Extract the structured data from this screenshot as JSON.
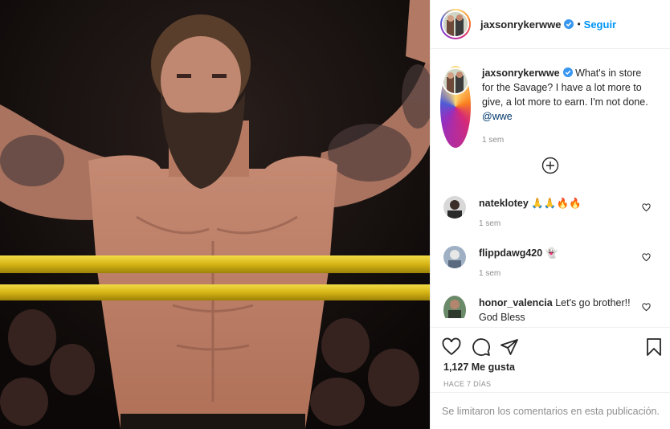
{
  "post": {
    "author": "jaxsonrykerwwe",
    "separator": "•",
    "follow_label": "Seguir",
    "caption_text": "What's in store for the Savage? I have a lot more to give, a lot more to earn. I'm not done.",
    "caption_mention": "@wwe",
    "caption_time": "1 sem",
    "likes": "1,127 Me gusta",
    "date": "HACE 7 DÍAS",
    "comments_limited": "Se limitaron los comentarios en esta publicación."
  },
  "comments": [
    {
      "user": "nateklotey",
      "text": "🙏🙏🔥🔥",
      "time": "1 sem"
    },
    {
      "user": "flippdawg420",
      "text": "👻",
      "time": "1 sem"
    },
    {
      "user": "honor_valencia",
      "text": "Let's go brother!! God Bless",
      "time": ""
    }
  ],
  "icons": {
    "verified": "verified-badge-icon",
    "more": "plus-circle-icon",
    "heart": "heart-icon",
    "comment": "comment-icon",
    "share": "paper-plane-icon",
    "save": "bookmark-icon"
  },
  "colors": {
    "link": "#0095f6",
    "mention": "#00376b",
    "muted": "#8e8e8e",
    "ring_yellow": "#e3c41b"
  }
}
